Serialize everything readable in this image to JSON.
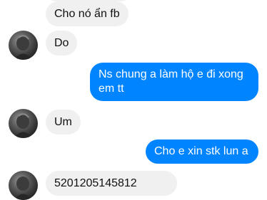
{
  "messages": [
    {
      "id": "m1",
      "direction": "incoming",
      "text": "Cho nó ẩn fb"
    },
    {
      "id": "m2",
      "direction": "incoming",
      "text": "Do"
    },
    {
      "id": "m3",
      "direction": "outgoing",
      "lines": [
        "Ns chung a làm hộ e đi xong",
        "em tt"
      ]
    },
    {
      "id": "m4",
      "direction": "incoming",
      "text": "Um"
    },
    {
      "id": "m5",
      "direction": "outgoing",
      "text": "Cho e xin stk lun a"
    },
    {
      "id": "m6",
      "direction": "incoming",
      "text": "5201205145812"
    }
  ],
  "colors": {
    "incoming_bubble": "#f1f0f0",
    "outgoing_bubble": "#0084ff",
    "outgoing_text": "#ffffff",
    "incoming_text": "#111111"
  }
}
